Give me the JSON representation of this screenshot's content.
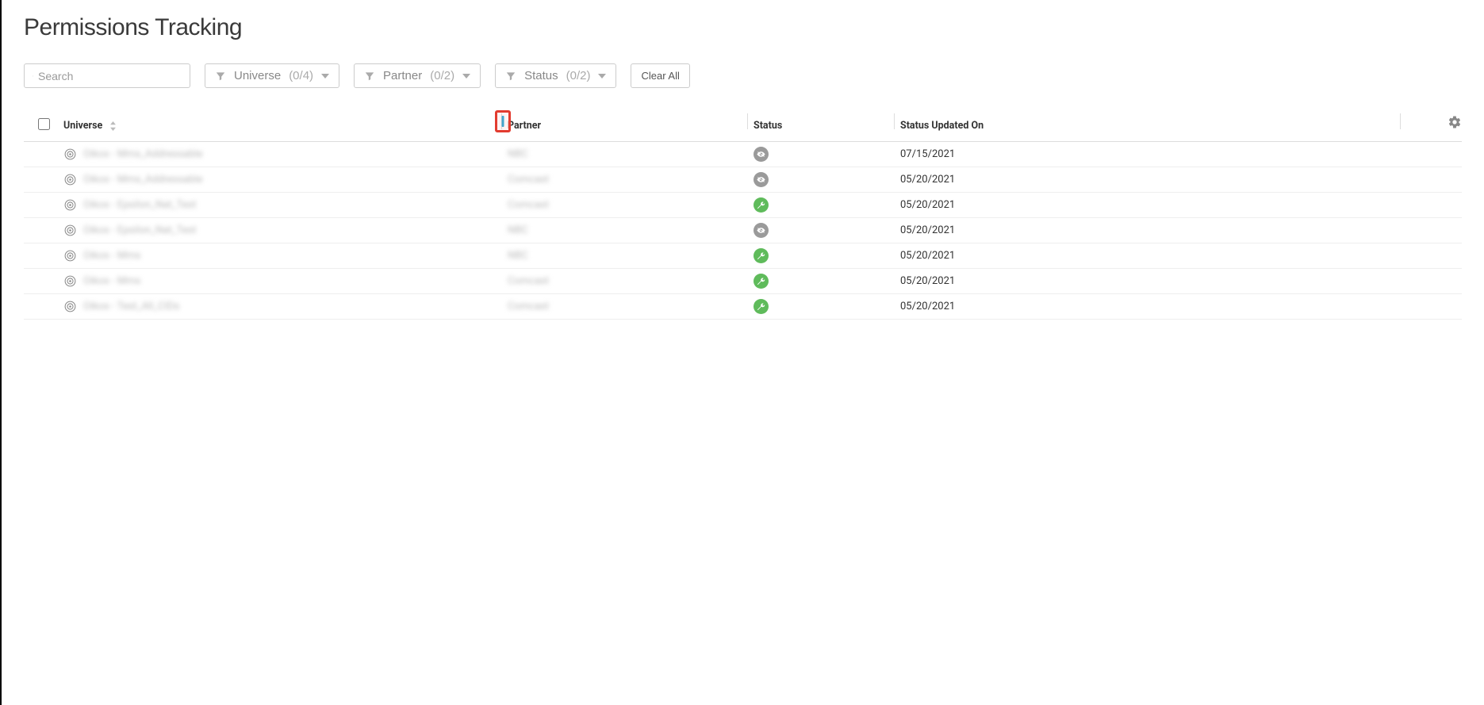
{
  "page": {
    "title": "Permissions Tracking"
  },
  "search": {
    "placeholder": "Search",
    "value": ""
  },
  "filters": {
    "universe": {
      "label": "Universe",
      "count": "(0/4)"
    },
    "partner": {
      "label": "Partner",
      "count": "(0/2)"
    },
    "status": {
      "label": "Status",
      "count": "(0/2)"
    },
    "clear": "Clear All"
  },
  "columns": {
    "universe": "Universe",
    "partner": "Partner",
    "status": "Status",
    "updated": "Status Updated On"
  },
  "rows": [
    {
      "universe": "Oikos - Mms_Addressable",
      "partner": "NBC",
      "status": "unavailable",
      "updated": "07/15/2021"
    },
    {
      "universe": "Oikos - Mms_Addressable",
      "partner": "Comcast",
      "status": "unavailable",
      "updated": "05/20/2021"
    },
    {
      "universe": "Oikos - Epsilon_Nat_Test",
      "partner": "Comcast",
      "status": "available",
      "updated": "05/20/2021"
    },
    {
      "universe": "Oikos - Epsilon_Nat_Test",
      "partner": "NBC",
      "status": "unavailable",
      "updated": "05/20/2021"
    },
    {
      "universe": "Oikos - Mms",
      "partner": "NBC",
      "status": "available",
      "updated": "05/20/2021"
    },
    {
      "universe": "Oikos - Mms",
      "partner": "Comcast",
      "status": "available",
      "updated": "05/20/2021"
    },
    {
      "universe": "Oikos - Test_All_CIDs",
      "partner": "Comcast",
      "status": "available",
      "updated": "05/20/2021"
    }
  ]
}
